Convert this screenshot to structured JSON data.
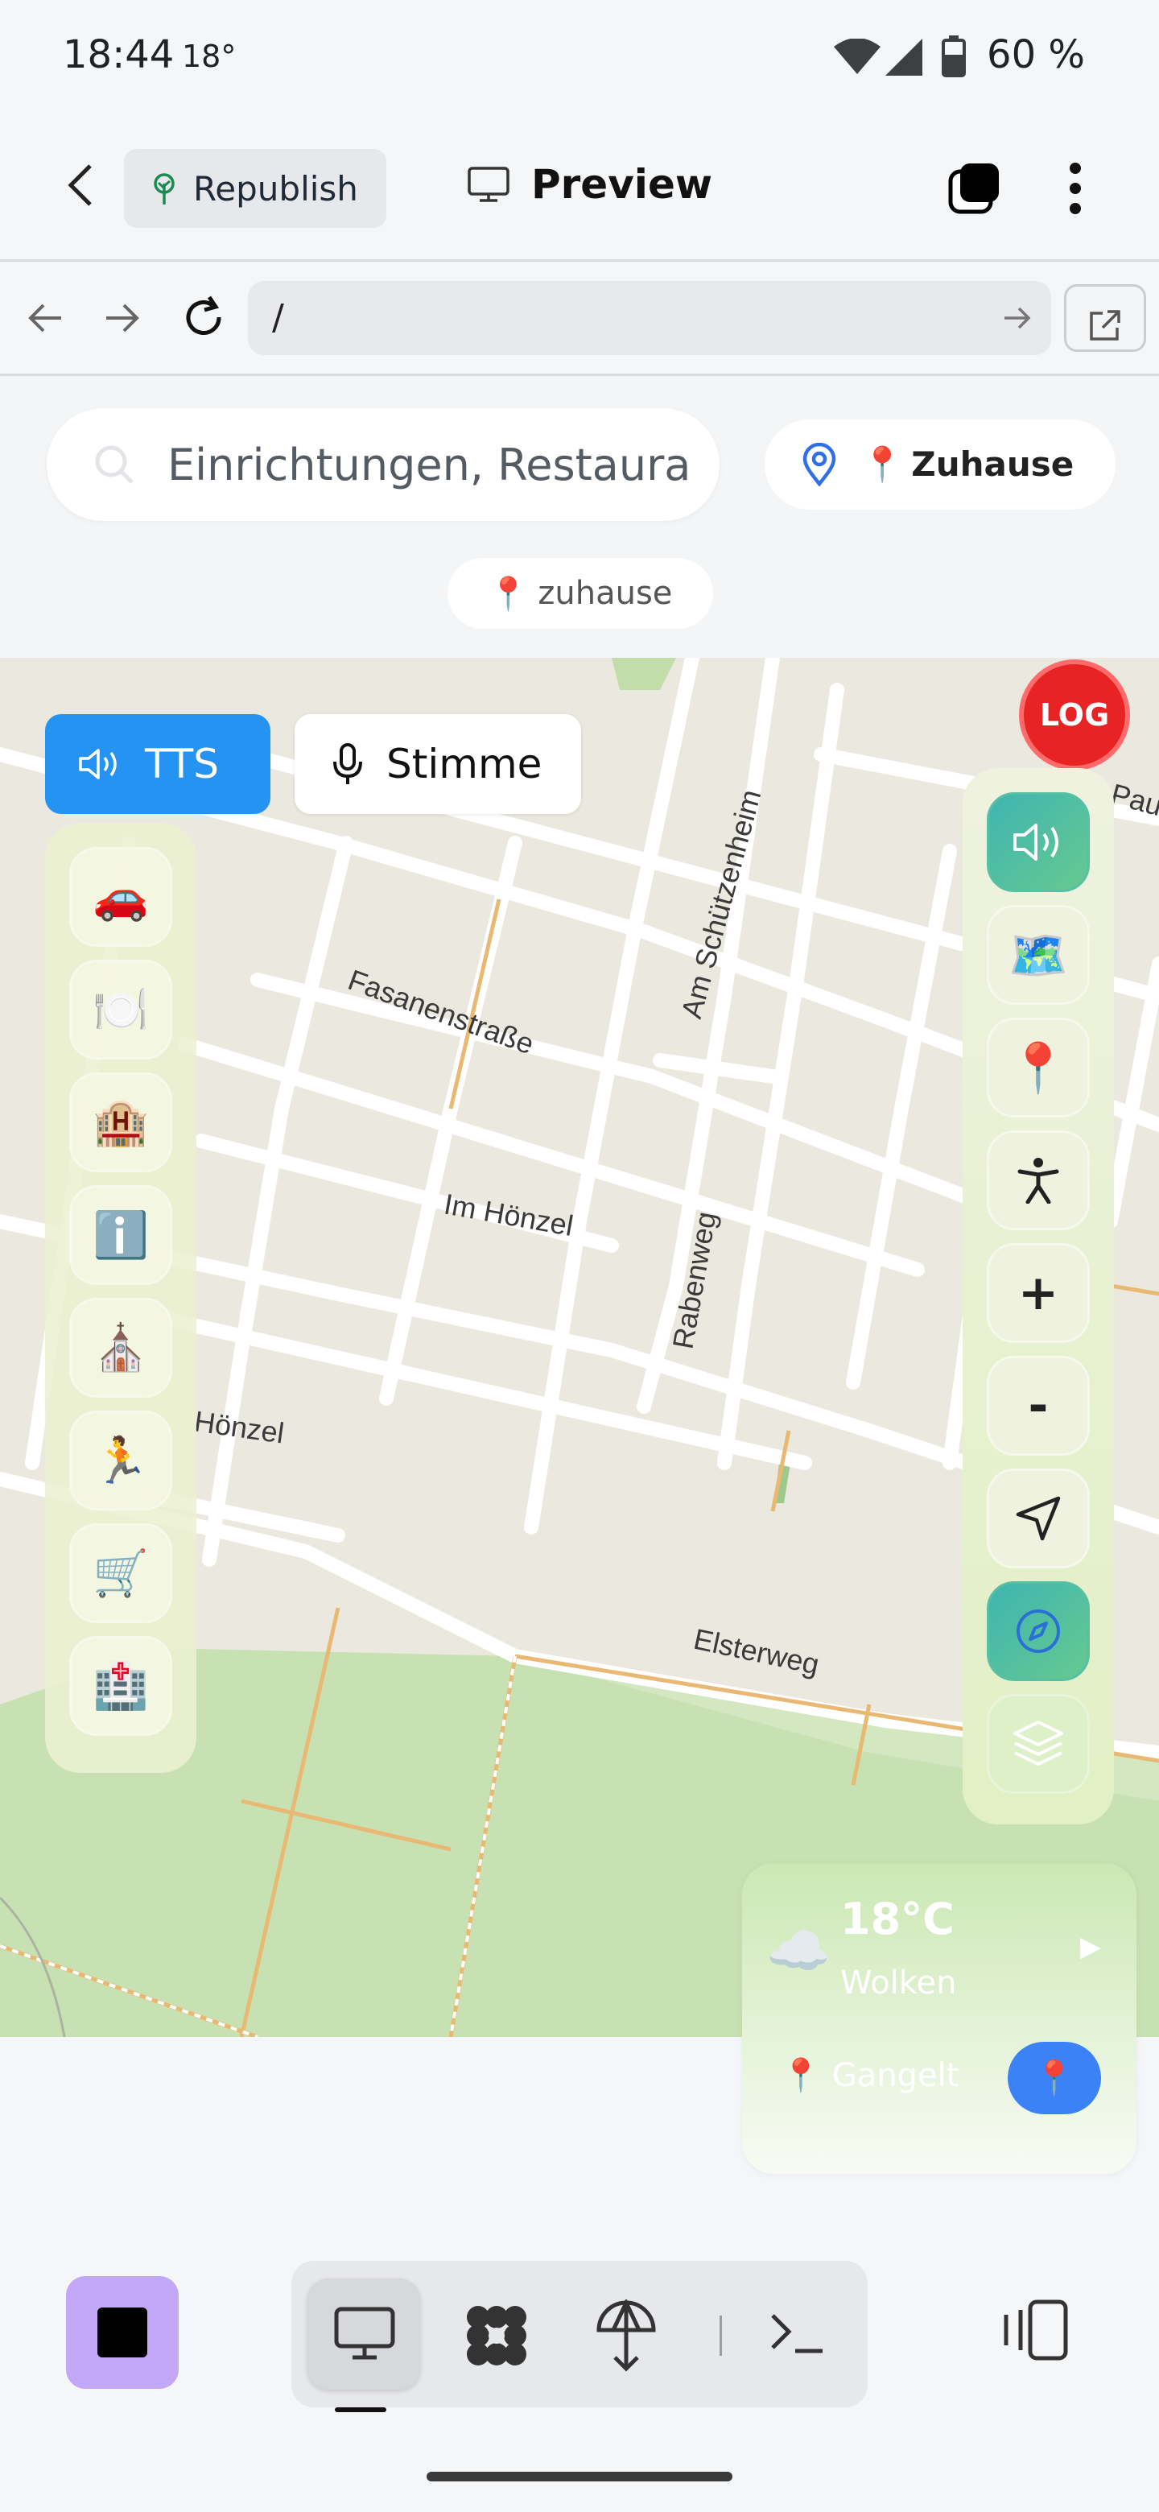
{
  "status_bar": {
    "time": "18:44",
    "temperature": "18°",
    "battery": "60 %"
  },
  "toolbar": {
    "republish_label": "Republish",
    "preview_label": "Preview"
  },
  "browser": {
    "url": "/"
  },
  "search": {
    "placeholder": "Einrichtungen, Restaura"
  },
  "home_chip": {
    "label": "Zuhause"
  },
  "tag_chip": {
    "label": "zuhause"
  },
  "voice_controls": {
    "tts_label": "TTS",
    "voice_label": "Stimme"
  },
  "log_button": {
    "label": "LOG"
  },
  "map": {
    "street_labels": [
      "Fasanenstraße",
      "Im Hönzel",
      "Rabenweg",
      "Am Schützenheim",
      "Elsterweg",
      "Hönzel",
      "Pau"
    ]
  },
  "categories": [
    {
      "name": "car",
      "icon": "🚗"
    },
    {
      "name": "food",
      "icon": "🍽️"
    },
    {
      "name": "hotel",
      "icon": "🏨"
    },
    {
      "name": "info",
      "icon": "ℹ️"
    },
    {
      "name": "church",
      "icon": "⛪"
    },
    {
      "name": "sport",
      "icon": "🏃"
    },
    {
      "name": "shopping",
      "icon": "🛒"
    },
    {
      "name": "hospital",
      "icon": "🏥"
    }
  ],
  "map_controls": {
    "map_icon": "🗺️",
    "pin_icon": "📍",
    "zoom_in": "+",
    "zoom_out": "-"
  },
  "weather": {
    "temperature": "18°C",
    "description": "Wolken",
    "location": "Gangelt",
    "cloud_icon": "☁️",
    "arrow": "▶",
    "pin_icon": "📍"
  },
  "colors": {
    "accent_blue": "#2593f2",
    "log_red": "#e82323",
    "app_purple": "#c4a8f8"
  }
}
